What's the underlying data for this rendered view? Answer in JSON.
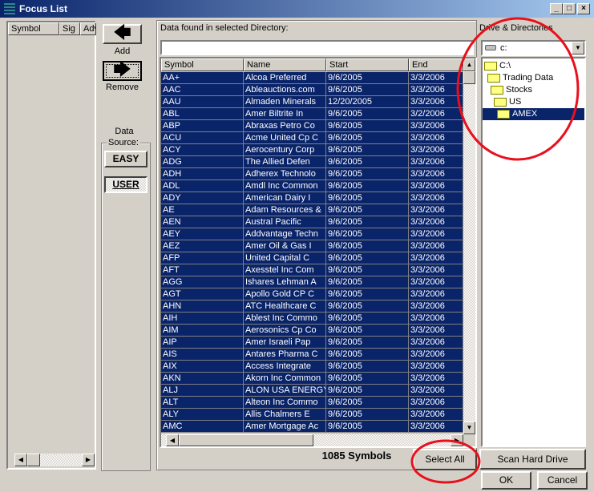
{
  "window": {
    "title": "Focus List"
  },
  "focus_list": {
    "columns": [
      "Symbol",
      "Sig",
      "Adv"
    ]
  },
  "buttons": {
    "add": "Add",
    "remove": "Remove",
    "easy": "EASY",
    "user": "USER",
    "select_all": "Select All",
    "scan": "Scan Hard Drive",
    "ok": "OK",
    "cancel": "Cancel"
  },
  "data_source": {
    "label_1": "Data",
    "label_2": "Source:",
    "selected": "USER"
  },
  "data_panel": {
    "label": "Data found in selected Directory:",
    "filter_value": "",
    "columns": [
      "Symbol",
      "Name",
      "Start",
      "End"
    ],
    "count_text": "1085 Symbols",
    "rows": [
      [
        "AA+",
        "Alcoa Preferred",
        "9/6/2005",
        "3/3/2006"
      ],
      [
        "AAC",
        "Ableauctions.com",
        "9/6/2005",
        "3/3/2006"
      ],
      [
        "AAU",
        "Almaden Minerals",
        "12/20/2005",
        "3/3/2006"
      ],
      [
        "ABL",
        "Amer Biltrite In",
        "9/6/2005",
        "3/2/2006"
      ],
      [
        "ABP",
        "Abraxas Petro Co",
        "9/6/2005",
        "3/3/2006"
      ],
      [
        "ACU",
        "Acme United Cp C",
        "9/6/2005",
        "3/3/2006"
      ],
      [
        "ACY",
        "Aerocentury Corp",
        "9/6/2005",
        "3/3/2006"
      ],
      [
        "ADG",
        "The Allied Defen",
        "9/6/2005",
        "3/3/2006"
      ],
      [
        "ADH",
        "Adherex Technolo",
        "9/6/2005",
        "3/3/2006"
      ],
      [
        "ADL",
        "Amdl Inc Common",
        "9/6/2005",
        "3/3/2006"
      ],
      [
        "ADY",
        "American Dairy I",
        "9/6/2005",
        "3/3/2006"
      ],
      [
        "AE",
        "Adam Resources &",
        "9/6/2005",
        "3/3/2006"
      ],
      [
        "AEN",
        "Austral Pacific",
        "9/6/2005",
        "3/3/2006"
      ],
      [
        "AEY",
        "Addvantage Techn",
        "9/6/2005",
        "3/3/2006"
      ],
      [
        "AEZ",
        "Amer Oil & Gas I",
        "9/6/2005",
        "3/3/2006"
      ],
      [
        "AFP",
        "United Capital C",
        "9/6/2005",
        "3/3/2006"
      ],
      [
        "AFT",
        "Axesstel Inc Com",
        "9/6/2005",
        "3/3/2006"
      ],
      [
        "AGG",
        "Ishares Lehman A",
        "9/6/2005",
        "3/3/2006"
      ],
      [
        "AGT",
        "Apollo Gold CP C",
        "9/6/2005",
        "3/3/2006"
      ],
      [
        "AHN",
        "ATC Healthcare C",
        "9/6/2005",
        "3/3/2006"
      ],
      [
        "AIH",
        "Ablest Inc Commo",
        "9/6/2005",
        "3/3/2006"
      ],
      [
        "AIM",
        "Aerosonics Cp Co",
        "9/6/2005",
        "3/3/2006"
      ],
      [
        "AIP",
        "Amer Israeli Pap",
        "9/6/2005",
        "3/3/2006"
      ],
      [
        "AIS",
        "Antares Pharma C",
        "9/6/2005",
        "3/3/2006"
      ],
      [
        "AIX",
        "Access Integrate",
        "9/6/2005",
        "3/3/2006"
      ],
      [
        "AKN",
        "Akorn Inc Common",
        "9/6/2005",
        "3/3/2006"
      ],
      [
        "ALJ",
        "ALON USA ENERGY",
        "9/6/2005",
        "3/3/2006"
      ],
      [
        "ALT",
        "Alteon Inc Commo",
        "9/6/2005",
        "3/3/2006"
      ],
      [
        "ALY",
        "Allis Chalmers E",
        "9/6/2005",
        "3/3/2006"
      ],
      [
        "AMC",
        "Amer Mortgage Ac",
        "9/6/2005",
        "3/3/2006"
      ]
    ]
  },
  "drive_panel": {
    "label": "Drive & Directories",
    "drive": "c:",
    "tree": [
      "C:\\",
      "Trading Data",
      "Stocks",
      "US",
      "AMEX"
    ],
    "selected": "AMEX"
  },
  "colors": {
    "selection": "#0a246a",
    "annotation": "#e8101c"
  }
}
